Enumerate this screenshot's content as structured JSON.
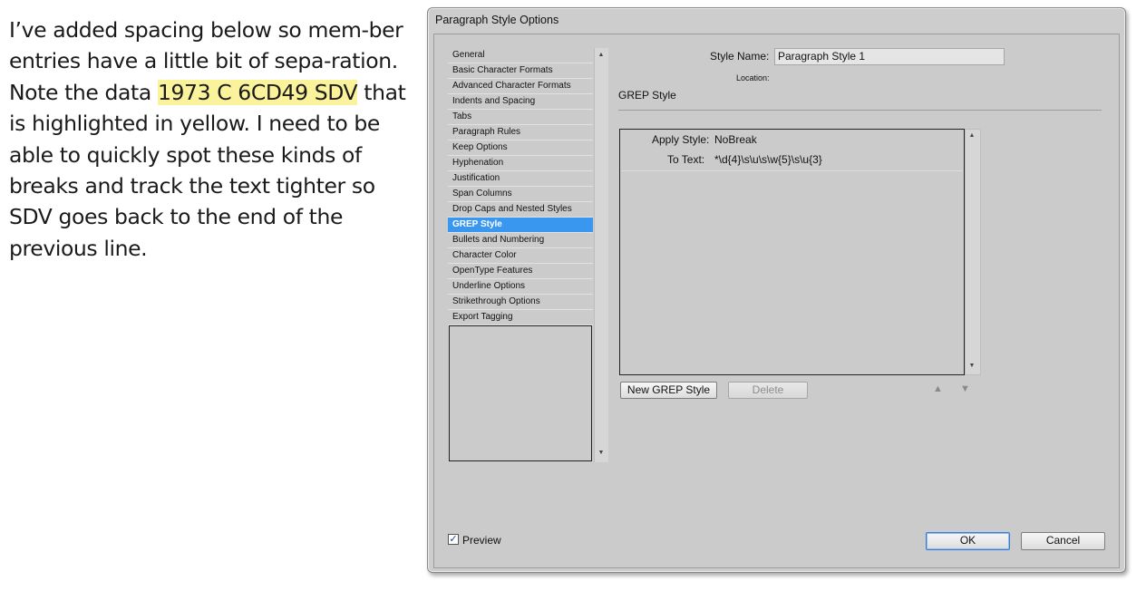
{
  "article": {
    "text_before": "I’ve added spacing below so mem-ber entries have a little bit of sepa-ration. Note the data ",
    "highlight": "1973 C 6CD49 SDV",
    "text_after": " that is highlighted in yellow. I need to be able to quickly spot these kinds of breaks and track the text tighter so SDV goes back to the end of the previous line.",
    "highlight_color": "#fbf39b"
  },
  "dialog": {
    "title": "Paragraph Style Options",
    "categories": [
      "General",
      "Basic Character Formats",
      "Advanced Character Formats",
      "Indents and Spacing",
      "Tabs",
      "Paragraph Rules",
      "Keep Options",
      "Hyphenation",
      "Justification",
      "Span Columns",
      "Drop Caps and Nested Styles",
      "GREP Style",
      "Bullets and Numbering",
      "Character Color",
      "OpenType Features",
      "Underline Options",
      "Strikethrough Options",
      "Export Tagging"
    ],
    "selected_category": "GREP Style",
    "selected_color": "#3a97f0",
    "style_name_label": "Style Name:",
    "style_name_value": "Paragraph Style 1",
    "location_label": "Location:",
    "section_title": "GREP Style",
    "grep_entry": {
      "apply_style_label": "Apply Style:",
      "apply_style_value": "NoBreak",
      "to_text_label": "To Text:",
      "to_text_value": "*\\d{4}\\s\\u\\s\\w{5}\\s\\u{3}"
    },
    "buttons": {
      "new_grep": "New GREP Style",
      "delete": "Delete",
      "ok": "OK",
      "cancel": "Cancel"
    },
    "preview_label": "Preview",
    "preview_checked": true
  }
}
